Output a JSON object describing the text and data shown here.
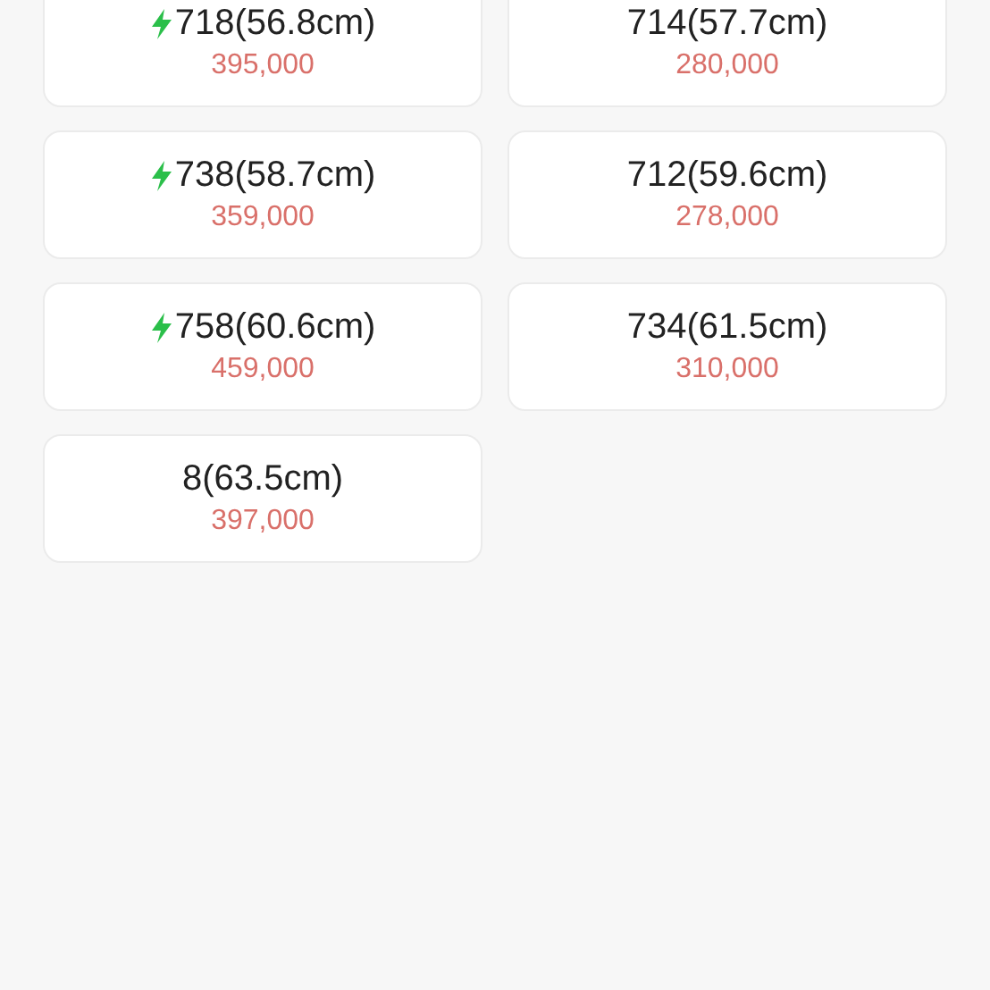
{
  "options": [
    {
      "size": "718(56.8cm)",
      "price": "395,000",
      "fast": true
    },
    {
      "size": "714(57.7cm)",
      "price": "280,000",
      "fast": false
    },
    {
      "size": "738(58.7cm)",
      "price": "359,000",
      "fast": true
    },
    {
      "size": "712(59.6cm)",
      "price": "278,000",
      "fast": false
    },
    {
      "size": "758(60.6cm)",
      "price": "459,000",
      "fast": true
    },
    {
      "size": "734(61.5cm)",
      "price": "310,000",
      "fast": false
    },
    {
      "size": "8(63.5cm)",
      "price": "397,000",
      "fast": false
    }
  ]
}
